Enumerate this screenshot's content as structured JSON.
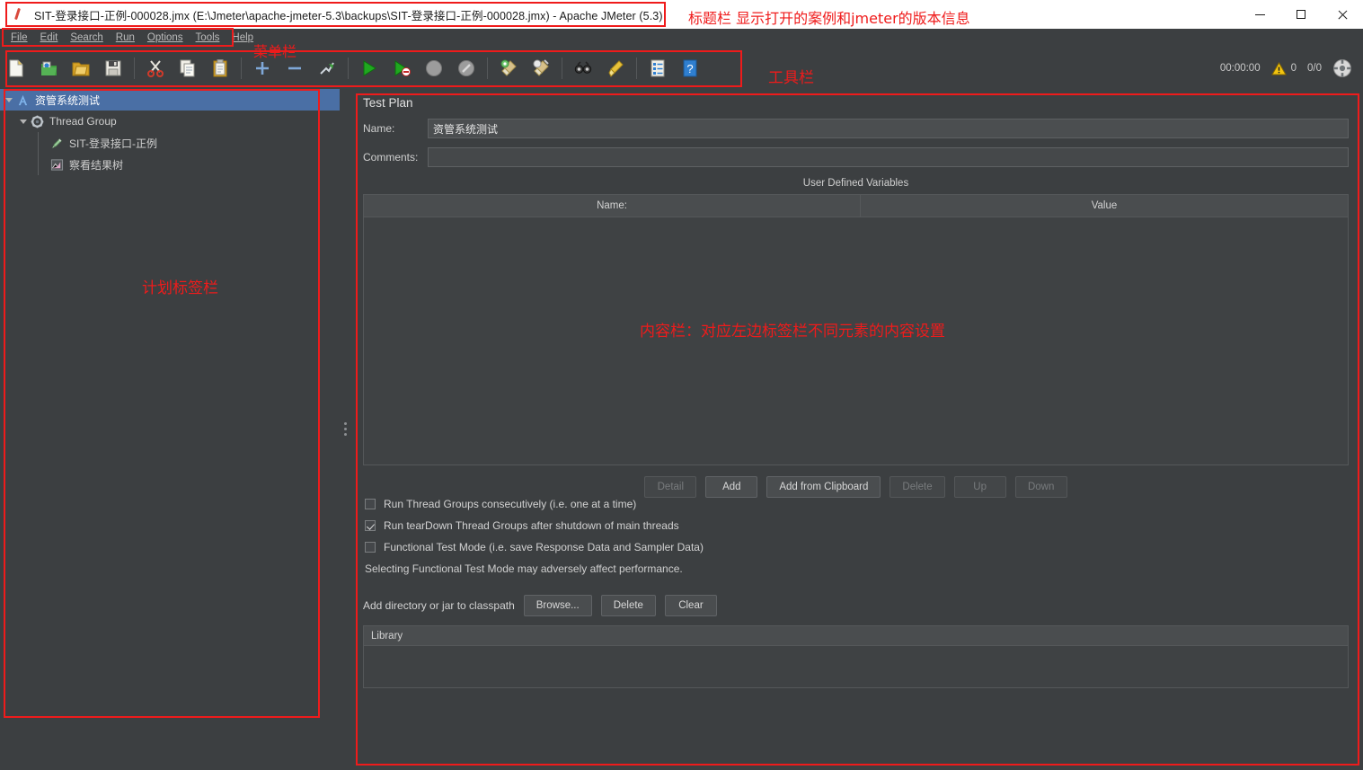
{
  "window": {
    "title": "SIT-登录接口-正例-000028.jmx (E:\\Jmeter\\apache-jmeter-5.3\\backups\\SIT-登录接口-正例-000028.jmx) - Apache JMeter (5.3)",
    "minimize": "—",
    "maximize": "□",
    "close": "✕"
  },
  "menubar": {
    "items": [
      {
        "label": "File"
      },
      {
        "label": "Edit"
      },
      {
        "label": "Search"
      },
      {
        "label": "Run"
      },
      {
        "label": "Options"
      },
      {
        "label": "Tools"
      },
      {
        "label": "Help"
      }
    ]
  },
  "toolbar": {
    "buttons": [
      {
        "name": "new-icon",
        "title": "New"
      },
      {
        "name": "templates-icon",
        "title": "Templates"
      },
      {
        "name": "open-icon",
        "title": "Open"
      },
      {
        "name": "save-icon",
        "title": "Save"
      },
      {
        "name": "cut-icon",
        "title": "Cut"
      },
      {
        "name": "copy-icon",
        "title": "Copy"
      },
      {
        "name": "paste-icon",
        "title": "Paste"
      },
      {
        "name": "expand-all-icon",
        "title": "Expand All"
      },
      {
        "name": "collapse-all-icon",
        "title": "Collapse All"
      },
      {
        "name": "toggle-icon",
        "title": "Toggle"
      },
      {
        "name": "start-icon",
        "title": "Start"
      },
      {
        "name": "start-no-pauses-icon",
        "title": "Start no pauses"
      },
      {
        "name": "stop-icon",
        "title": "Stop"
      },
      {
        "name": "shutdown-icon",
        "title": "Shutdown"
      },
      {
        "name": "clear-icon",
        "title": "Clear"
      },
      {
        "name": "clear-all-icon",
        "title": "Clear All"
      },
      {
        "name": "search-icon",
        "title": "Search"
      },
      {
        "name": "reset-search-icon",
        "title": "Reset Search"
      },
      {
        "name": "function-helper-icon",
        "title": "Function Helper Dialog"
      },
      {
        "name": "help-icon",
        "title": "Help"
      }
    ],
    "status": {
      "elapsed": "00:00:00",
      "warnings": "0",
      "threads": "0/0"
    }
  },
  "tree": {
    "nodes": [
      {
        "label": "资管系统测试",
        "icon": "test-plan-icon",
        "selected": true,
        "depth": 0,
        "expanded": true
      },
      {
        "label": "Thread Group",
        "icon": "thread-group-icon",
        "selected": false,
        "depth": 1,
        "expanded": true
      },
      {
        "label": "SIT-登录接口-正例",
        "icon": "http-sampler-icon",
        "selected": false,
        "depth": 2,
        "expanded": false
      },
      {
        "label": "察看结果树",
        "icon": "view-results-tree-icon",
        "selected": false,
        "depth": 2,
        "expanded": false
      }
    ]
  },
  "content": {
    "title": "Test Plan",
    "name_label": "Name:",
    "name_value": "资管系统测试",
    "comments_label": "Comments:",
    "comments_value": "",
    "udv_title": "User Defined Variables",
    "table_headers": {
      "name": "Name:",
      "value": "Value"
    },
    "table_rows": [],
    "buttons": [
      {
        "label": "Detail",
        "disabled": true
      },
      {
        "label": "Add",
        "disabled": false
      },
      {
        "label": "Add from Clipboard",
        "disabled": false
      },
      {
        "label": "Delete",
        "disabled": true
      },
      {
        "label": "Up",
        "disabled": true
      },
      {
        "label": "Down",
        "disabled": true
      }
    ],
    "checkboxes": [
      {
        "label": "Run Thread Groups consecutively (i.e. one at a time)",
        "checked": false
      },
      {
        "label": "Run tearDown Thread Groups after shutdown of main threads",
        "checked": true
      },
      {
        "label": "Functional Test Mode (i.e. save Response Data and Sampler Data)",
        "checked": false
      }
    ],
    "note": "Selecting Functional Test Mode may adversely affect performance.",
    "classpath_label": "Add directory or jar to classpath",
    "classpath_buttons": [
      {
        "label": "Browse..."
      },
      {
        "label": "Delete"
      },
      {
        "label": "Clear"
      }
    ],
    "library_header": "Library"
  },
  "annotations": {
    "title_bar": "标题栏 显示打开的案例和jmeter的版本信息",
    "menu_bar": "菜单栏",
    "tool_bar": "工具栏",
    "tree_panel": "计划标签栏",
    "content_panel": "内容栏：对应左边标签栏不同元素的内容设置",
    "color": "#ef1b1b"
  }
}
